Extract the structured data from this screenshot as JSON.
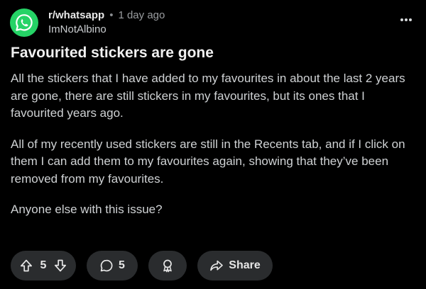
{
  "post": {
    "subreddit": "r/whatsapp",
    "separator": "•",
    "time": "1 day ago",
    "author": "ImNotAlbino",
    "title": "Favourited stickers are gone",
    "paragraphs": [
      "All the stickers that I have added to my favourites in about the last 2 years are gone, there are still stickers in my favourites, but its ones that I favourited years ago.",
      "All of my recently used stickers are still in the Recents tab, and if I click on them I can add them to my favourites again, showing that they’ve been removed from my favourites.",
      "Anyone else with this issue?"
    ]
  },
  "actions": {
    "vote_count": "5",
    "comment_count": "5",
    "share_label": "Share"
  },
  "icons": {
    "avatar": "whatsapp-logo",
    "more": "more-options-icon",
    "upvote": "upvote-arrow-icon",
    "downvote": "downvote-arrow-icon",
    "comment": "comment-bubble-icon",
    "award": "award-icon",
    "share": "share-arrow-icon"
  },
  "colors": {
    "background": "#000000",
    "pill": "#2a2c2e",
    "whatsapp_green": "#25d366"
  }
}
